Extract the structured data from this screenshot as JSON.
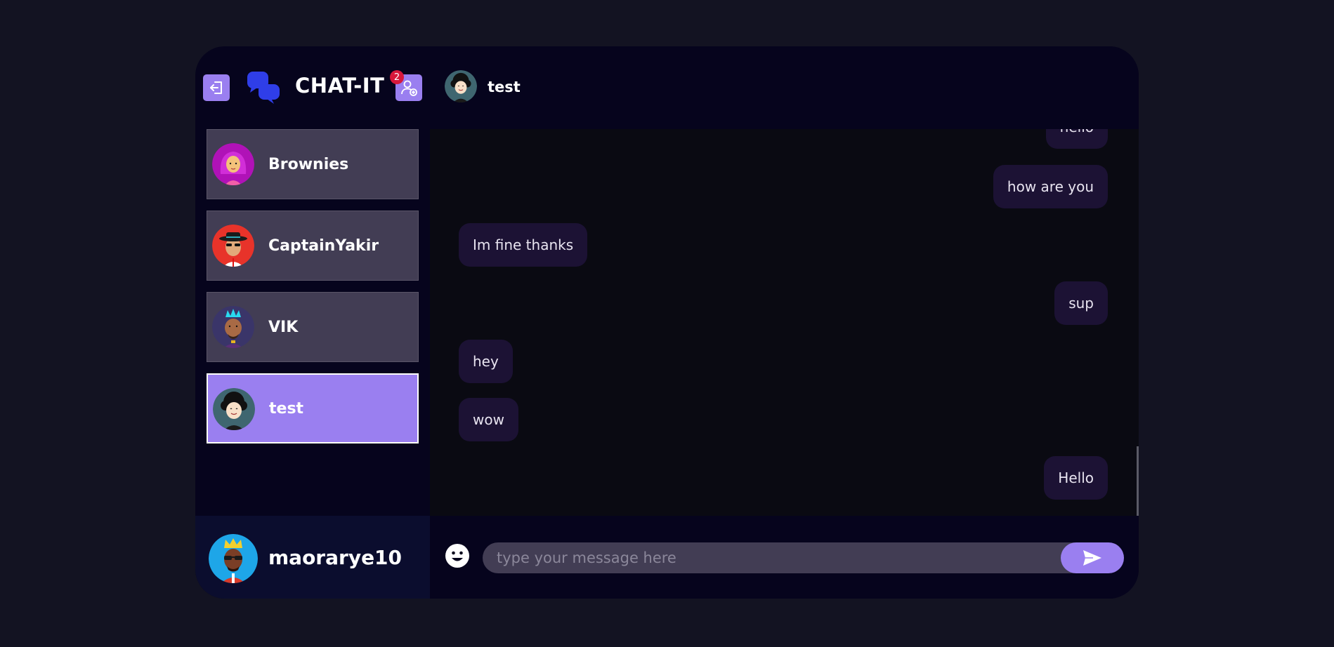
{
  "app": {
    "title": "CHAT-IT",
    "friend_requests_count": "2"
  },
  "contacts": [
    {
      "name": "Brownies",
      "avatar": "woman-pink-hair-avatar"
    },
    {
      "name": "CaptainYakir",
      "avatar": "man-hat-sunglasses-avatar"
    },
    {
      "name": "VIK",
      "avatar": "man-blue-mohawk-avatar"
    },
    {
      "name": "test",
      "avatar": "man-curly-hair-avatar",
      "selected": true
    }
  ],
  "current_user": {
    "name": "maorarye10",
    "avatar": "man-crown-sunglasses-avatar"
  },
  "chat": {
    "partner_name": "test",
    "messages": [
      {
        "text": "hello",
        "from": "me"
      },
      {
        "text": "how are you",
        "from": "me"
      },
      {
        "text": "Im fine thanks",
        "from": "them"
      },
      {
        "text": "sup",
        "from": "me"
      },
      {
        "text": "hey",
        "from": "them"
      },
      {
        "text": "wow",
        "from": "them"
      },
      {
        "text": "Hello",
        "from": "me"
      }
    ]
  },
  "composer": {
    "placeholder": "type your message here"
  },
  "colors": {
    "accent": "#9a7ff0",
    "bubble": "#1c1234",
    "badge": "#d7183b",
    "logo": "#2f3ee8"
  }
}
